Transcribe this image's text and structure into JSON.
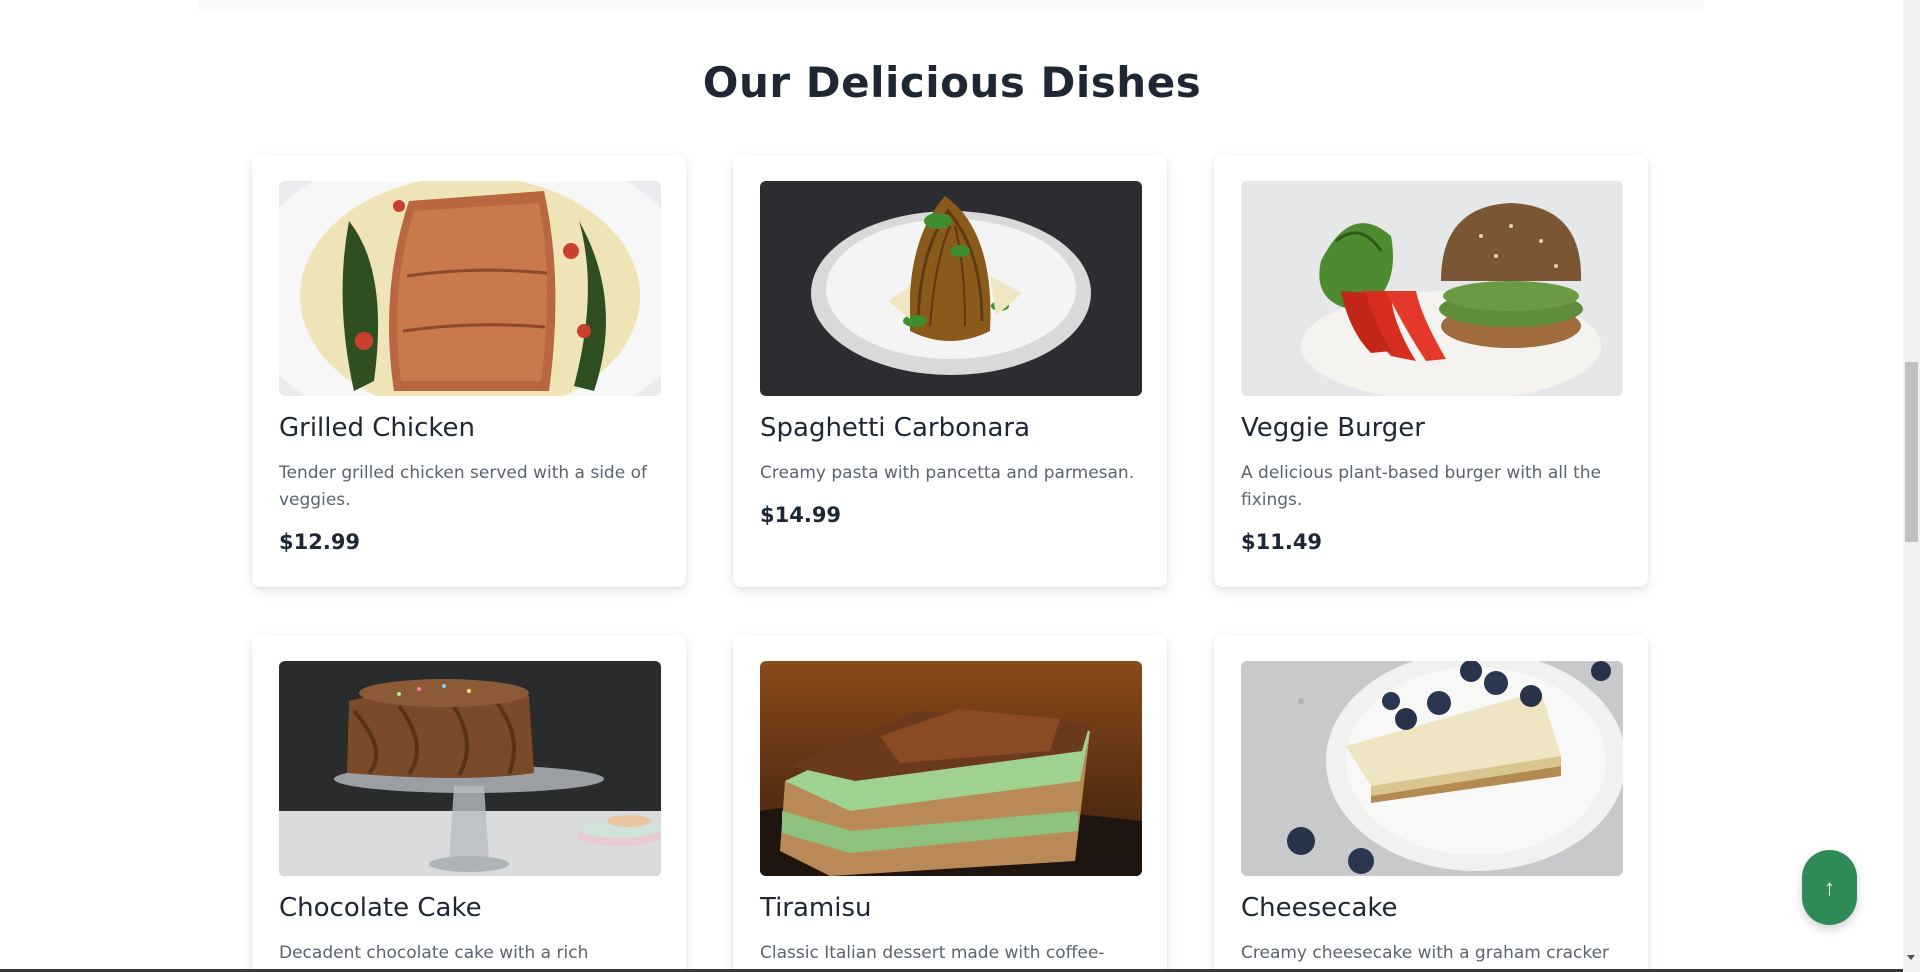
{
  "section": {
    "title": "Our Delicious Dishes"
  },
  "dishes": [
    {
      "name": "Grilled Chicken",
      "description": "Tender grilled chicken served with a side of veggies.",
      "price": "$12.99",
      "image_icon": "salmon-plate-image"
    },
    {
      "name": "Spaghetti Carbonara",
      "description": "Creamy pasta with pancetta and parmesan.",
      "price": "$14.99",
      "image_icon": "pasta-plate-image"
    },
    {
      "name": "Veggie Burger",
      "description": "A delicious plant-based burger with all the fixings.",
      "price": "$11.49",
      "image_icon": "burger-plate-image"
    },
    {
      "name": "Chocolate Cake",
      "description": "Decadent chocolate cake with a rich ganache.",
      "price": "",
      "image_icon": "chocolate-cake-image"
    },
    {
      "name": "Tiramisu",
      "description": "Classic Italian dessert made with coffee-soaked",
      "price": "",
      "image_icon": "tiramisu-image"
    },
    {
      "name": "Cheesecake",
      "description": "Creamy cheesecake with a graham cracker crust.",
      "price": "",
      "image_icon": "cheesecake-image"
    }
  ],
  "scroll_top_button": {
    "label": "↑"
  },
  "colors": {
    "accent": "#2e8b57",
    "heading": "#1e2733",
    "muted_text": "#5a6470"
  }
}
